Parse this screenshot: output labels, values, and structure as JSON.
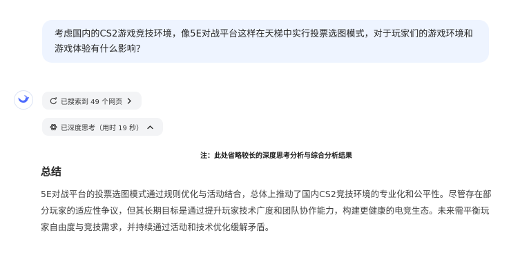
{
  "user_message": {
    "text": "考虑国内的CS2游戏竞技环境，像5E对战平台这样在天梯中实行投票选图模式，对于玩家们的游戏环境和游戏体验有什么影响？"
  },
  "assistant": {
    "avatar_icon": "whale-logo-icon",
    "search_pill": {
      "label": "已搜索到 49 个网页",
      "icon": "search-refresh-icon",
      "chevron": "chevron-right-icon"
    },
    "think_pill": {
      "label": "已深度思考（用时 19 秒）",
      "icon": "deep-think-icon",
      "chevron": "chevron-up-icon"
    },
    "note": "注：此处省略较长的深度思考分析与综合分析结果",
    "section_title": "总结",
    "answer_text": "5E对战平台的投票选图模式通过规则优化与活动结合，总体上推动了国内CS2竞技环境的专业化和公平性。尽管存在部分玩家的适应性争议，但其长期目标是通过提升玩家技术广度和团队协作能力，构建更健康的电竞生态。未来需平衡玩家自由度与竞技需求，并持续通过活动和技术优化缓解矛盾。"
  },
  "colors": {
    "bubble_bg": "#eef4ff",
    "pill_bg": "#f3f4f6",
    "brand": "#4d6bfe"
  }
}
